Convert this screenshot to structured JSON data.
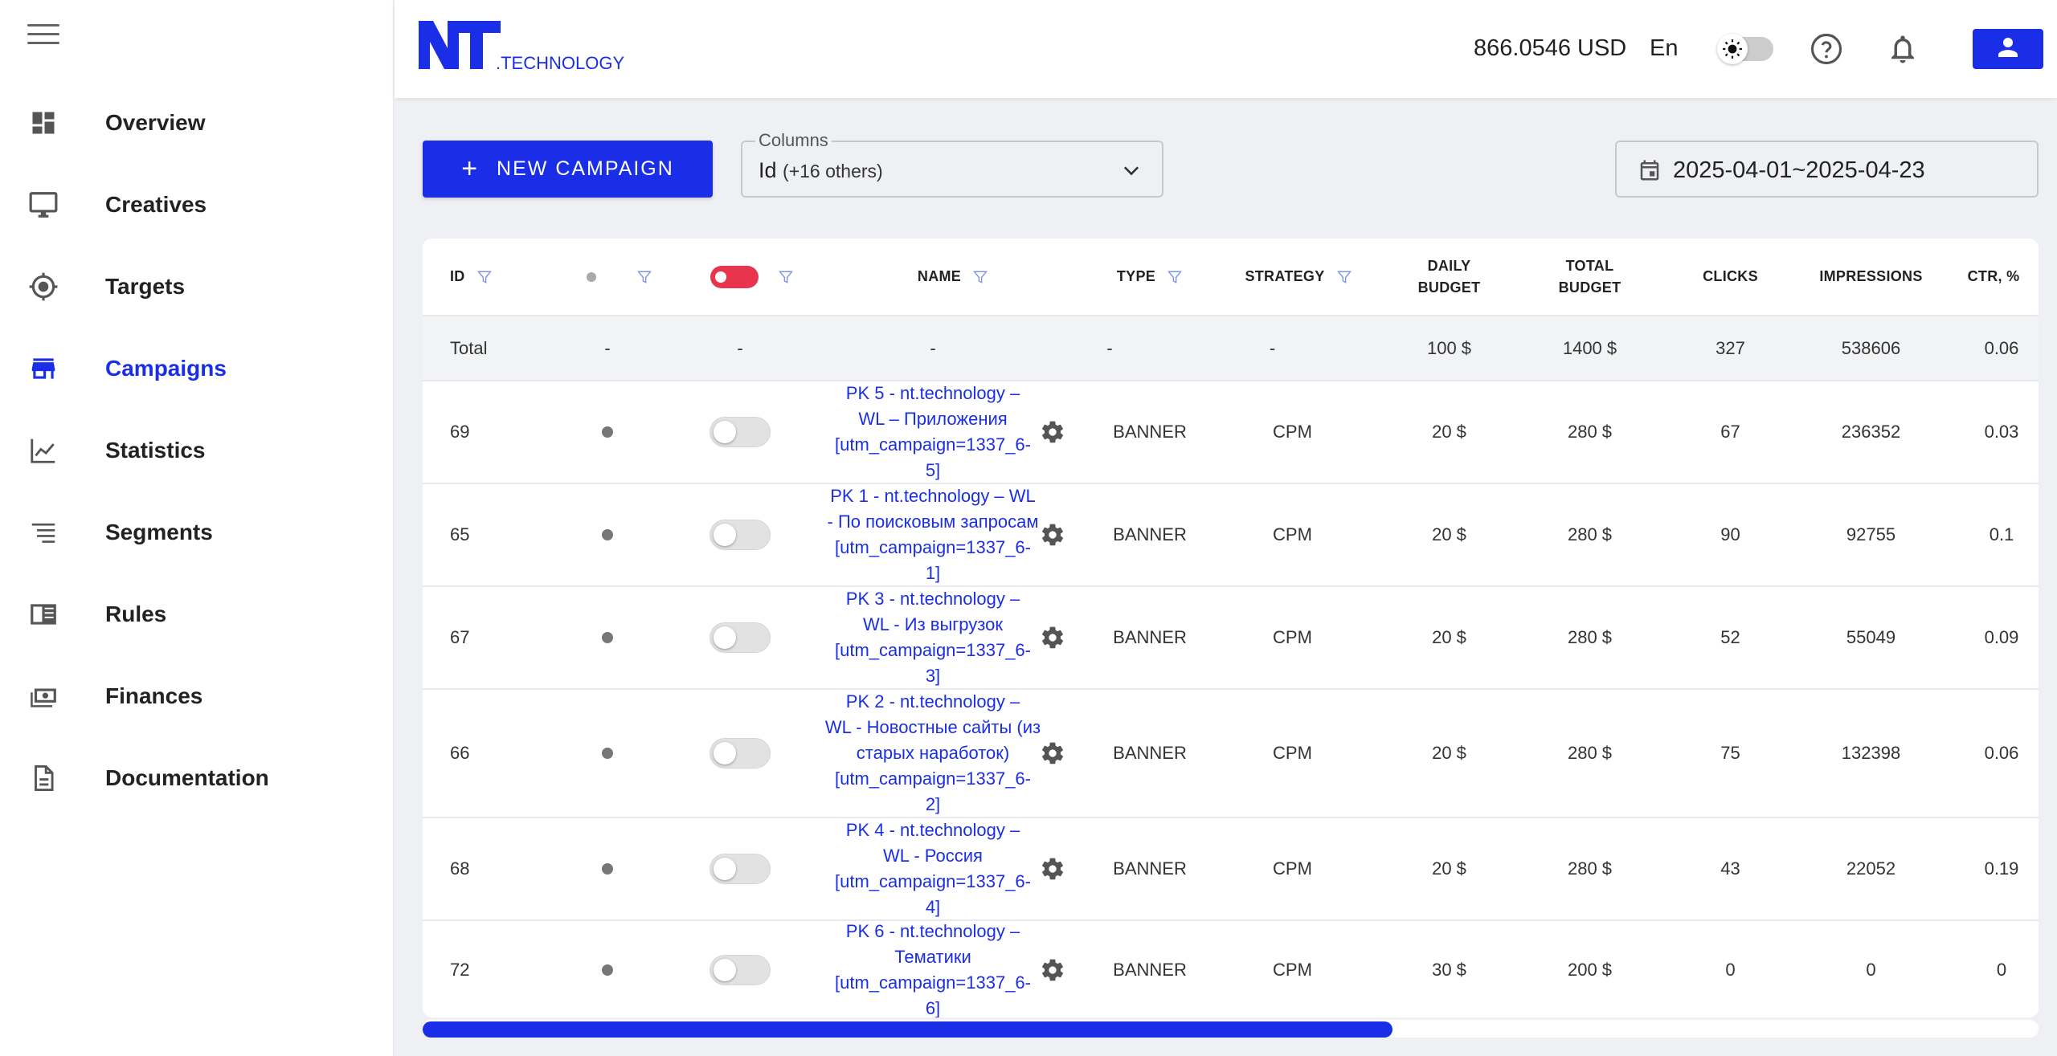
{
  "brand": {
    "logo_main": "NT",
    "logo_sub": ".TECHNOLOGY",
    "color": "#1a2ee8"
  },
  "sidebar": {
    "items": [
      {
        "label": "Overview",
        "icon": "dashboard-icon"
      },
      {
        "label": "Creatives",
        "icon": "monitor-icon"
      },
      {
        "label": "Targets",
        "icon": "crosshair-icon"
      },
      {
        "label": "Campaigns",
        "icon": "store-icon",
        "active": true
      },
      {
        "label": "Statistics",
        "icon": "line-chart-icon"
      },
      {
        "label": "Segments",
        "icon": "list-icon"
      },
      {
        "label": "Rules",
        "icon": "book-icon"
      },
      {
        "label": "Finances",
        "icon": "money-icon"
      },
      {
        "label": "Documentation",
        "icon": "document-icon"
      }
    ]
  },
  "header": {
    "balance": "866.0546 USD",
    "language": "En"
  },
  "toolbar": {
    "new_campaign_label": "NEW CAMPAIGN",
    "columns_label": "Columns",
    "columns_value": "Id",
    "columns_others": "(+16 others)",
    "date_range": "2025-04-01~2025-04-23"
  },
  "table": {
    "headers": {
      "id": "ID",
      "name": "NAME",
      "type": "TYPE",
      "strategy": "STRATEGY",
      "daily_budget_1": "DAILY",
      "daily_budget_2": "BUDGET",
      "total_budget_1": "TOTAL",
      "total_budget_2": "BUDGET",
      "clicks": "CLICKS",
      "impressions": "IMPRESSIONS",
      "ctr": "CTR, %"
    },
    "total": {
      "label": "Total",
      "status": "-",
      "active": "-",
      "name": "-",
      "type": "-",
      "strategy": "-",
      "daily_budget": "100 $",
      "total_budget": "1400 $",
      "clicks": "327",
      "impressions": "538606",
      "ctr": "0.06"
    },
    "rows": [
      {
        "id": "69",
        "name": "PK 5 - nt.technology –\nWL – Приложения\n[utm_campaign=1337_6-\n5]",
        "type": "BANNER",
        "strategy": "CPM",
        "daily_budget": "20 $",
        "total_budget": "280 $",
        "clicks": "67",
        "impressions": "236352",
        "ctr": "0.03"
      },
      {
        "id": "65",
        "name": "PK 1 - nt.technology – WL\n- По поисковым запросам\n[utm_campaign=1337_6-\n1]",
        "type": "BANNER",
        "strategy": "CPM",
        "daily_budget": "20 $",
        "total_budget": "280 $",
        "clicks": "90",
        "impressions": "92755",
        "ctr": "0.1"
      },
      {
        "id": "67",
        "name": "PK 3 - nt.technology –\nWL - Из выгрузок\n[utm_campaign=1337_6-\n3]",
        "type": "BANNER",
        "strategy": "CPM",
        "daily_budget": "20 $",
        "total_budget": "280 $",
        "clicks": "52",
        "impressions": "55049",
        "ctr": "0.09"
      },
      {
        "id": "66",
        "name": "PK 2 - nt.technology –\nWL - Новостные сайты (из\nстарых наработок)\n[utm_campaign=1337_6-\n2]",
        "type": "BANNER",
        "strategy": "CPM",
        "daily_budget": "20 $",
        "total_budget": "280 $",
        "clicks": "75",
        "impressions": "132398",
        "ctr": "0.06"
      },
      {
        "id": "68",
        "name": "PK 4 - nt.technology –\nWL - Россия\n[utm_campaign=1337_6-\n4]",
        "type": "BANNER",
        "strategy": "CPM",
        "daily_budget": "20 $",
        "total_budget": "280 $",
        "clicks": "43",
        "impressions": "22052",
        "ctr": "0.19"
      },
      {
        "id": "72",
        "name": "PK 6 - nt.technology –\nТематики\n[utm_campaign=1337_6-\n6]",
        "type": "BANNER",
        "strategy": "CPM",
        "daily_budget": "30 $",
        "total_budget": "200 $",
        "clicks": "0",
        "impressions": "0",
        "ctr": "0"
      }
    ]
  },
  "scrollbar": {
    "position_fraction": 0.6
  }
}
